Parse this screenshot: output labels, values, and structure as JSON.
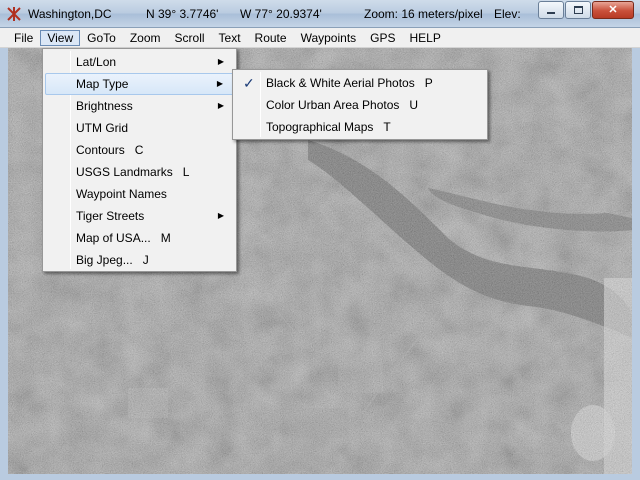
{
  "titlebar": {
    "place": "Washington,DC",
    "lat": "N 39° 3.7746'",
    "lon": "W  77° 20.9374'",
    "zoom": "Zoom: 16 meters/pixel",
    "elev": "Elev:"
  },
  "menubar": {
    "items": [
      "File",
      "View",
      "GoTo",
      "Zoom",
      "Scroll",
      "Text",
      "Route",
      "Waypoints",
      "GPS",
      "HELP"
    ],
    "active": "View"
  },
  "view_menu": {
    "items": [
      {
        "label": "Lat/Lon",
        "shortcut": "",
        "submenu": true
      },
      {
        "label": "Map Type",
        "shortcut": "",
        "submenu": true,
        "highlighted": true
      },
      {
        "label": "Brightness",
        "shortcut": "",
        "submenu": true
      },
      {
        "label": "UTM Grid",
        "shortcut": "",
        "submenu": false
      },
      {
        "label": "Contours",
        "shortcut": "C",
        "submenu": false
      },
      {
        "label": "USGS Landmarks",
        "shortcut": "L",
        "submenu": false
      },
      {
        "label": "Waypoint Names",
        "shortcut": "",
        "submenu": false
      },
      {
        "label": "Tiger Streets",
        "shortcut": "",
        "submenu": true
      },
      {
        "label": "Map of USA...",
        "shortcut": "M",
        "submenu": false
      },
      {
        "label": "Big Jpeg...",
        "shortcut": "J",
        "submenu": false
      }
    ]
  },
  "maptype_menu": {
    "items": [
      {
        "label": "Black & White Aerial Photos",
        "shortcut": "P",
        "checked": true
      },
      {
        "label": "Color Urban Area Photos",
        "shortcut": "U",
        "checked": false
      },
      {
        "label": "Topographical Maps",
        "shortcut": "T",
        "checked": false
      }
    ]
  },
  "glyphs": {
    "check": "✓",
    "arrow": "▶",
    "close": "✕"
  },
  "icons": {
    "app": "app-logo-icon",
    "minimize": "minimize-icon",
    "maximize": "maximize-icon",
    "close": "close-icon"
  },
  "colors": {
    "map_base": "#5b5b5b",
    "river": "#4a4a4a",
    "menu_bg": "#f1f1f1",
    "menu_highlight": "#d7e7f8",
    "close_button": "#c9503a"
  }
}
